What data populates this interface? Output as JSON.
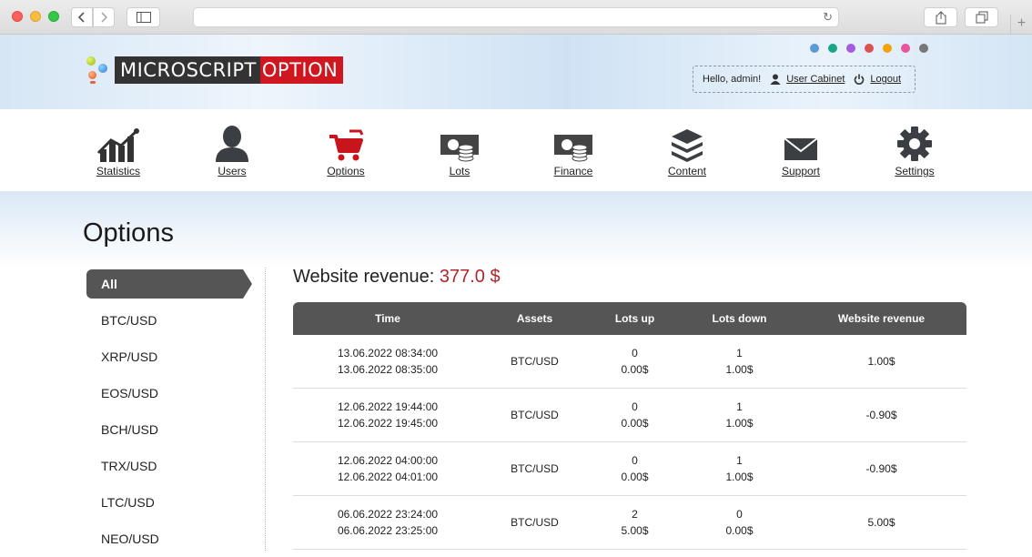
{
  "browser": {
    "back_icon": "chevron-left-icon",
    "forward_icon": "chevron-right-icon",
    "url": ""
  },
  "brand": {
    "logo_part1": "MICROSCRIPT",
    "logo_part2": "OPTION",
    "theme_colors": [
      "#5b9bd5",
      "#1aa686",
      "#a45de0",
      "#d9534f",
      "#f0a30a",
      "#e8559b",
      "#777777"
    ]
  },
  "userbox": {
    "greeting": "Hello, admin!",
    "cabinet_label": "User Cabinet",
    "logout_label": "Logout"
  },
  "nav": [
    {
      "label": "Statistics",
      "icon": "statistics-icon"
    },
    {
      "label": "Users",
      "icon": "user-icon"
    },
    {
      "label": "Options",
      "icon": "cart-icon"
    },
    {
      "label": "Lots",
      "icon": "coins-icon"
    },
    {
      "label": "Finance",
      "icon": "finance-icon"
    },
    {
      "label": "Content",
      "icon": "layers-icon"
    },
    {
      "label": "Support",
      "icon": "envelope-icon"
    },
    {
      "label": "Settings",
      "icon": "gear-icon"
    }
  ],
  "page": {
    "title": "Options",
    "revenue_label": "Website revenue:",
    "revenue_value": "377.0 $"
  },
  "filters": [
    "All",
    "BTC/USD",
    "XRP/USD",
    "EOS/USD",
    "BCH/USD",
    "TRX/USD",
    "LTC/USD",
    "NEO/USD"
  ],
  "table": {
    "headers": [
      "Time",
      "Assets",
      "Lots up",
      "Lots down",
      "Website revenue"
    ],
    "rows": [
      {
        "time_start": "13.06.2022 08:34:00",
        "time_end": "13.06.2022 08:35:00",
        "asset": "BTC/USD",
        "lots_up": "0",
        "lots_up_sum": "0.00$",
        "lots_down": "1",
        "lots_down_sum": "1.00$",
        "revenue": "1.00$"
      },
      {
        "time_start": "12.06.2022 19:44:00",
        "time_end": "12.06.2022 19:45:00",
        "asset": "BTC/USD",
        "lots_up": "0",
        "lots_up_sum": "0.00$",
        "lots_down": "1",
        "lots_down_sum": "1.00$",
        "revenue": "-0.90$"
      },
      {
        "time_start": "12.06.2022 04:00:00",
        "time_end": "12.06.2022 04:01:00",
        "asset": "BTC/USD",
        "lots_up": "0",
        "lots_up_sum": "0.00$",
        "lots_down": "1",
        "lots_down_sum": "1.00$",
        "revenue": "-0.90$"
      },
      {
        "time_start": "06.06.2022 23:24:00",
        "time_end": "06.06.2022 23:25:00",
        "asset": "BTC/USD",
        "lots_up": "2",
        "lots_up_sum": "5.00$",
        "lots_down": "0",
        "lots_down_sum": "0.00$",
        "revenue": "5.00$"
      }
    ]
  }
}
